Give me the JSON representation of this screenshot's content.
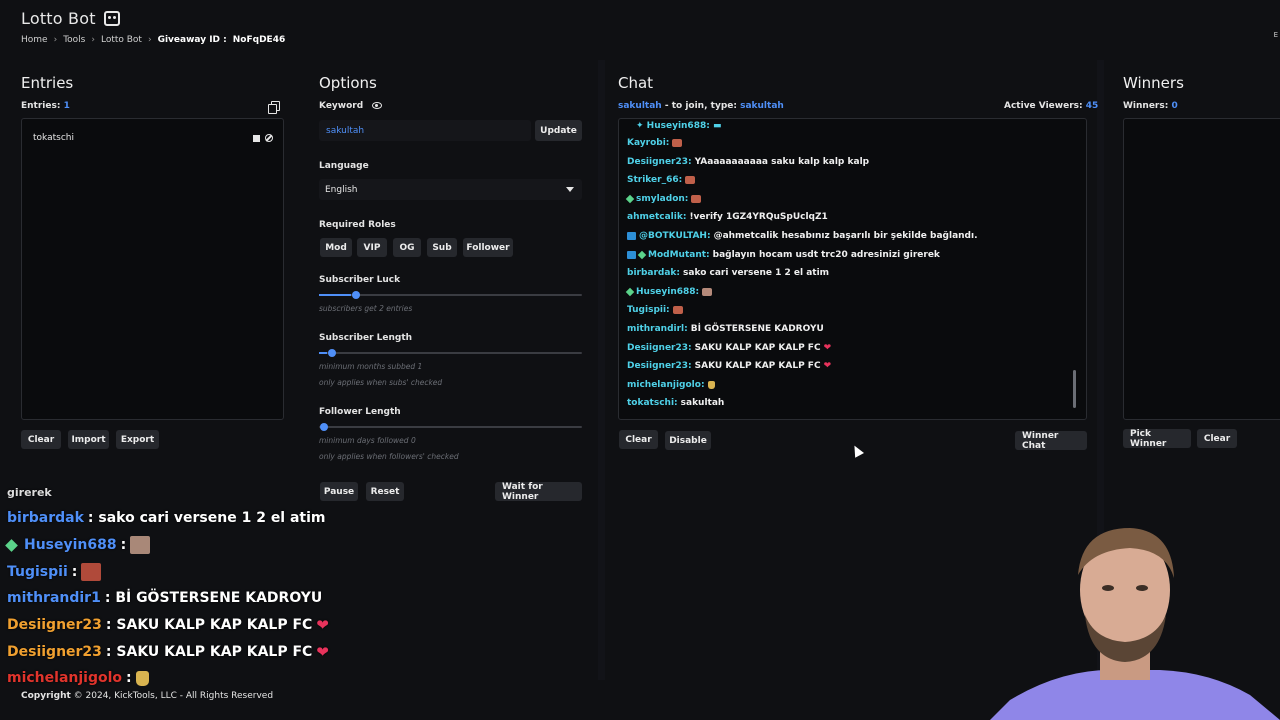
{
  "header": {
    "title": "Lotto Bot",
    "breadcrumb": [
      "Home",
      "Tools",
      "Lotto Bot"
    ],
    "breadcrumb_giveaway_label": "Giveaway ID :",
    "breadcrumb_giveaway_id": "NoFqDE46",
    "edge_letter": "E"
  },
  "entries": {
    "title": "Entries",
    "count_label": "Entries:",
    "count": "1",
    "items": [
      "tokatschi"
    ],
    "buttons": {
      "clear": "Clear",
      "import": "Import",
      "export": "Export"
    }
  },
  "options": {
    "title": "Options",
    "keyword_label": "Keyword",
    "keyword_value": "sakultah",
    "update_button": "Update",
    "language_label": "Language",
    "language_value": "English",
    "roles_label": "Required Roles",
    "roles": [
      "Mod",
      "VIP",
      "OG",
      "Sub",
      "Follower"
    ],
    "sub_luck_label": "Subscriber Luck",
    "sub_luck_hint": "subscribers get 2 entries",
    "sub_luck_level": 0.12,
    "sub_length_label": "Subscriber Length",
    "sub_length_hint1": "minimum months subbed 1",
    "sub_length_hint2": "only applies when subs' checked",
    "sub_length_level": 0.03,
    "follower_length_label": "Follower Length",
    "follower_length_hint1": "minimum days followed 0",
    "follower_length_hint2": "only applies when followers' checked",
    "follower_length_level": 0.0,
    "buttons": {
      "pause": "Pause",
      "reset": "Reset",
      "wait": "Wait for Winner"
    }
  },
  "chat": {
    "title": "Chat",
    "channel": "sakultah",
    "join_text": "- to join, type:",
    "join_keyword": "sakultah",
    "viewers_label": "Active Viewers:",
    "viewers_count": "45",
    "messages": [
      {
        "user": "Kayrobi:",
        "msg": ""
      },
      {
        "user": "Desiigner23:",
        "msg": "YAaaaaaaaaaa saku kalp kalp kalp"
      },
      {
        "user": "Striker_66:",
        "msg": ""
      },
      {
        "user": "smyladon:",
        "msg": ""
      },
      {
        "user": "ahmetcalik:",
        "msg": "!verify 1GZ4YRQuSpUclqZ1"
      },
      {
        "user": "@BOTKULTAH:",
        "msg": "@ahmetcalik hesabınız başarılı bir şekilde bağlandı."
      },
      {
        "user": "ModMutant:",
        "msg": "bağlayın hocam usdt trc20 adresinizi girerek"
      },
      {
        "user": "birbardak:",
        "msg": "sako cari versene 1 2 el atim"
      },
      {
        "user": "Huseyin688:",
        "msg": ""
      },
      {
        "user": "Tugispii:",
        "msg": ""
      },
      {
        "user": "mithrandirl:",
        "msg": "Bİ GÖSTERSENE KADROYU"
      },
      {
        "user": "Desiigner23:",
        "msg": "SAKU KALP KAP KALP FC"
      },
      {
        "user": "Desiigner23:",
        "msg": "SAKU KALP KAP KALP FC"
      },
      {
        "user": "michelanjigolo:",
        "msg": ""
      },
      {
        "user": "tokatschi:",
        "msg": "sakultah"
      }
    ],
    "buttons": {
      "clear": "Clear",
      "disable": "Disable",
      "winner_chat": "Winner Chat"
    }
  },
  "winners": {
    "title": "Winners",
    "count_label": "Winners:",
    "count": "0",
    "buttons": {
      "pick": "Pick Winner",
      "clear": "Clear"
    }
  },
  "overlay_chat": {
    "partial": "girerek",
    "lines": [
      {
        "user": "birbardak",
        "msg": ": sako cari versene 1 2 el atim"
      },
      {
        "user": "Huseyin688",
        "msg": ":"
      },
      {
        "user": "Tugispii",
        "msg": ":"
      },
      {
        "user": "mithrandir1",
        "msg": ": Bİ GÖSTERSENE KADROYU"
      },
      {
        "user": "Desiigner23",
        "msg": ": SAKU KALP KAP KALP FC"
      },
      {
        "user": "Desiigner23",
        "msg": ": SAKU KALP KAP KALP FC"
      },
      {
        "user": "michelanjigolo",
        "msg": ":"
      }
    ]
  },
  "footer": {
    "copyright": "Copyright",
    "text": "© 2024, KickTools, LLC - All Rights Reserved"
  },
  "colors": {
    "accent": "#4f8ff7",
    "background": "#0f1013",
    "panel": "#0a0b0d"
  }
}
